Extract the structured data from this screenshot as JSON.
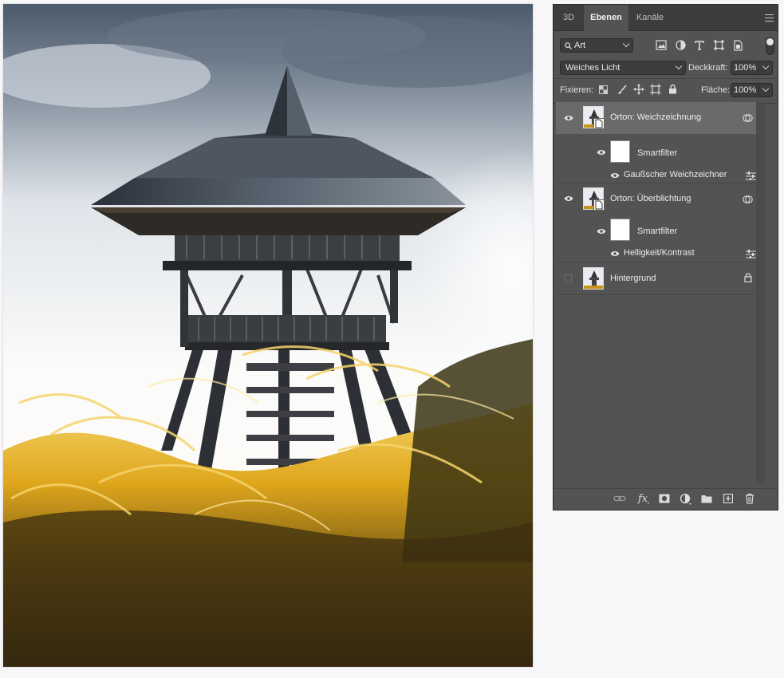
{
  "panel": {
    "tabs": [
      "3D",
      "Ebenen",
      "Kanäle"
    ],
    "active_tab": "Ebenen",
    "filter": {
      "value": "Art"
    },
    "blend_mode": "Weiches Licht",
    "opacity_label": "Deckkraft:",
    "opacity_value": "100%",
    "lock_label": "Fixieren:",
    "fill_label": "Fläche:",
    "fill_value": "100%"
  },
  "layers": [
    {
      "name": "Orton: Weichzeichnung",
      "visible": true,
      "selected": true,
      "smart_filter_label": "Smartfilter",
      "filter": "Gaußscher Weichzeichner"
    },
    {
      "name": "Orton: Überblichtung",
      "visible": true,
      "selected": false,
      "smart_filter_label": "Smartfilter",
      "filter": "Helligkeit/Kontrast"
    },
    {
      "name": "Hintergrund",
      "visible": false,
      "selected": false,
      "locked": true
    }
  ],
  "footer_icons": [
    "link-icon",
    "fx-icon",
    "mask-icon",
    "adjustment-icon",
    "folder-icon",
    "new-layer-icon",
    "trash-icon"
  ],
  "colors": {
    "panel_bg": "#535353",
    "tab_bar_bg": "#3d3d3d",
    "selected_row": "#6a6a6a",
    "grass_gold": "#e8b020"
  }
}
